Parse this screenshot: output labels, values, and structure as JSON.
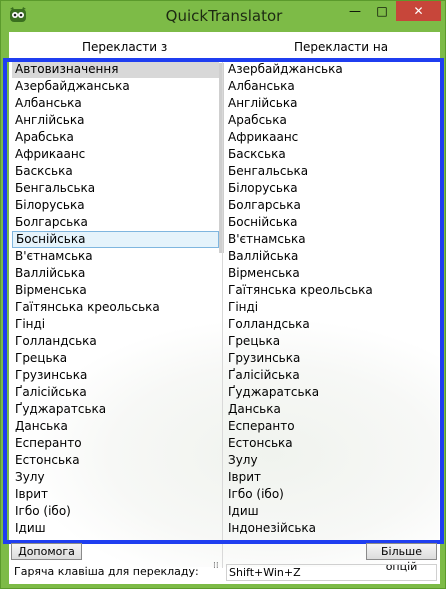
{
  "window": {
    "title": "QuickTranslator",
    "minimize": "—",
    "maximize": "□",
    "close": "✕",
    "icon": "owl-app-icon"
  },
  "headers": {
    "from": "Перекласти з",
    "to": "Перекласти на"
  },
  "from_list": [
    "Автовизначення",
    "Азербайджанська",
    "Албанська",
    "Англійська",
    "Арабська",
    "Африкаанс",
    "Баскська",
    "Бенгальська",
    "Білоруська",
    "Болгарська",
    "Боснійська",
    "В'єтнамська",
    "Валлійська",
    "Вірменська",
    "Гаїтянська креольська",
    "Гінді",
    "Голландська",
    "Грецька",
    "Грузинська",
    "Ґалісійська",
    "Ґуджаратська",
    "Данська",
    "Есперанто",
    "Естонська",
    "Зулу",
    "Іврит",
    "Ігбо (ібо)",
    "Ідиш"
  ],
  "from_selected": "Автовизначення",
  "from_focused": "Боснійська",
  "to_list": [
    "Азербайджанська",
    "Албанська",
    "Англійська",
    "Арабська",
    "Африкаанс",
    "Баскська",
    "Бенгальська",
    "Білоруська",
    "Болгарська",
    "Боснійська",
    "В'єтнамська",
    "Валлійська",
    "Вірменська",
    "Гаїтянська креольська",
    "Гінді",
    "Голландська",
    "Грецька",
    "Грузинська",
    "Ґалісійська",
    "Ґуджаратська",
    "Данська",
    "Есперанто",
    "Естонська",
    "Зулу",
    "Іврит",
    "Ігбо (ібо)",
    "Ідиш",
    "Індонезійська"
  ],
  "buttons": {
    "help": "Допомога",
    "more": "Більше опцій"
  },
  "hotkey": {
    "label": "Гаряча клавіша для перекладу:",
    "value": "Shift+Win+Z"
  },
  "colors": {
    "window_frame": "#7dbb47",
    "highlight_frame": "#1f3ef0",
    "close_button": "#c7463a"
  }
}
